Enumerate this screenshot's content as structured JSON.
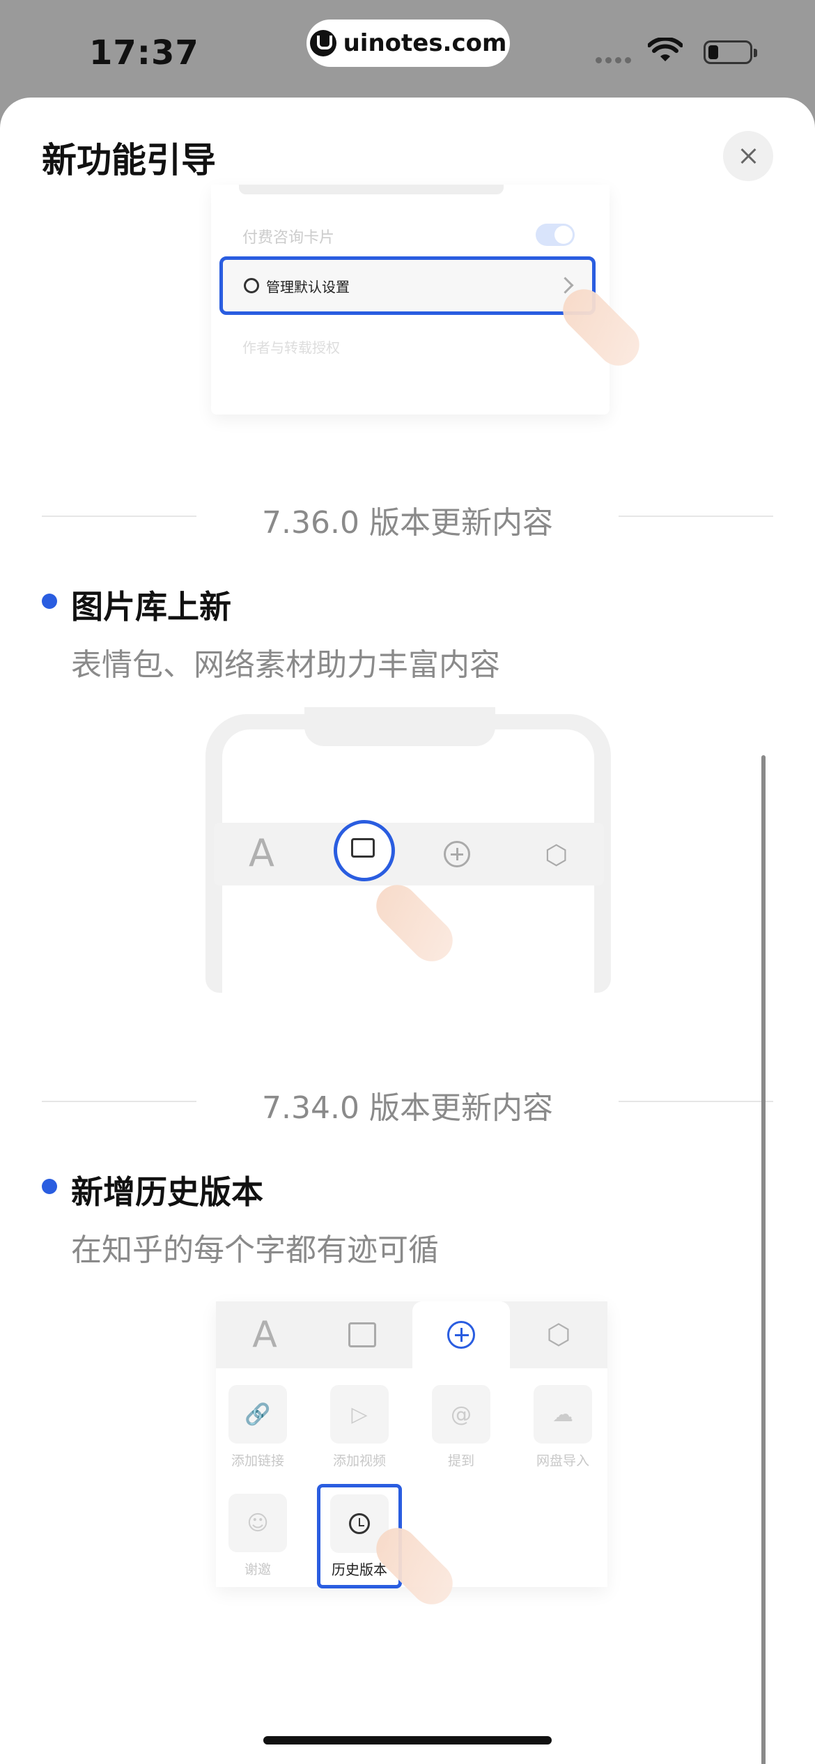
{
  "status_bar": {
    "time": "17:37",
    "url": "uinotes.com"
  },
  "sheet": {
    "title": "新功能引导",
    "close_icon": "close-icon"
  },
  "illustration_settings": {
    "faint_row_top": "付费咨询卡片",
    "highlight_row": "管理默认设置",
    "faint_row_bottom": "作者与转载授权"
  },
  "sections": [
    {
      "version": "7.36.0 版本更新内容",
      "feature_title": "图片库上新",
      "feature_subtitle": "表情包、网络素材助力丰富内容"
    },
    {
      "version": "7.34.0 版本更新内容",
      "feature_title": "新增历史版本",
      "feature_subtitle": "在知乎的每个字都有迹可循"
    }
  ],
  "illustration_phone_toolbar": {
    "text_tool": "A"
  },
  "illustration_history": {
    "tab_text": "A",
    "items": [
      "添加链接",
      "添加视频",
      "提到",
      "网盘导入",
      "谢邀"
    ],
    "highlight_item": "历史版本"
  },
  "colors": {
    "accent": "#2a5de0",
    "muted_text": "#8a8a8a",
    "backdrop": "#9a9a9a"
  }
}
